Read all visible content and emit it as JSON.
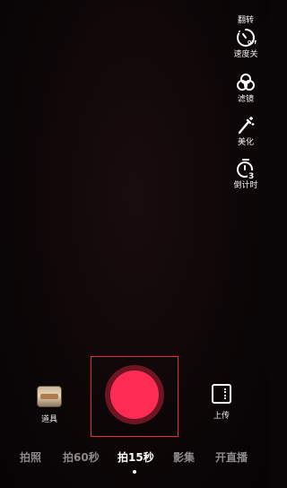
{
  "tools": {
    "flip": {
      "label": "翻转",
      "icon": "flip-camera-icon"
    },
    "speed": {
      "label": "速度关",
      "icon": "speed-icon"
    },
    "filter": {
      "label": "滤镜",
      "icon": "filter-icon"
    },
    "beauty": {
      "label": "美化",
      "icon": "beauty-wand-icon"
    },
    "timer": {
      "label": "倒计时",
      "icon": "countdown-timer-icon",
      "badge": "3"
    }
  },
  "bottom": {
    "props_label": "道具",
    "upload_label": "上传"
  },
  "modes": {
    "items": [
      "拍照",
      "拍60秒",
      "拍15秒",
      "影集",
      "开直播"
    ],
    "active_index": 2
  },
  "colors": {
    "record": "#fe2c55",
    "record_ring": "#6e1522",
    "highlight_box": "#e8283f",
    "background": "#0a0506"
  }
}
